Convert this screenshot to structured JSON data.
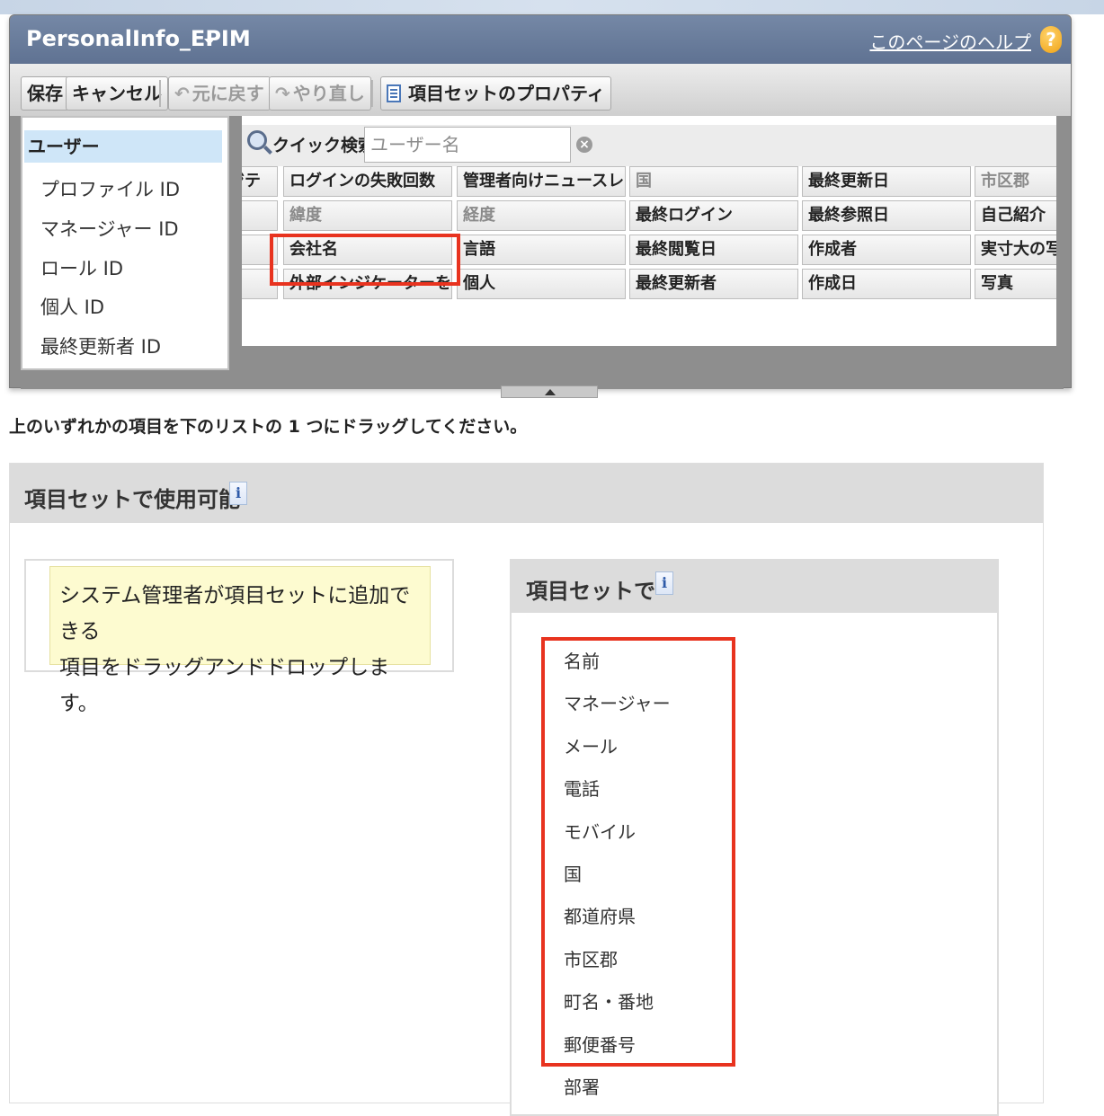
{
  "editor": {
    "title": "PersonalInfo_EPIM",
    "help_link": "このページのヘルプ",
    "help_icon_glyph": "?"
  },
  "toolbar": {
    "save": "保存",
    "cancel": "キャンセル",
    "undo": "元に戻す",
    "redo": "やり直し",
    "properties": "項目セットのプロパティ"
  },
  "field_list": {
    "header": "ユーザー",
    "items": [
      "プロファイル ID",
      "マネージャー ID",
      "ロール ID",
      "個人 ID",
      "最終更新者 ID"
    ]
  },
  "quick_search": {
    "label": "クイック検索",
    "placeholder": "ユーザー名",
    "clear_glyph": "×"
  },
  "grid": {
    "rows": [
      [
        "ッジテ",
        "ログインの失敗回数",
        "管理者向けニュースレター",
        "国",
        "最終更新日",
        "市区郡"
      ],
      [
        "",
        "緯度",
        "経度",
        "最終ログイン",
        "最終参照日",
        "自己紹介"
      ],
      [
        "",
        "会社名",
        "言語",
        "最終閲覧日",
        "作成者",
        "実寸大の写真"
      ],
      [
        "",
        "外部インジケーターを表示",
        "個人",
        "最終更新者",
        "作成日",
        "写真"
      ]
    ],
    "muted": [
      [
        false,
        false,
        false,
        true,
        false,
        true
      ],
      [
        false,
        true,
        true,
        false,
        false,
        false
      ],
      [
        false,
        false,
        false,
        false,
        false,
        false
      ],
      [
        false,
        false,
        false,
        false,
        false,
        false
      ]
    ]
  },
  "instruction": "上のいずれかの項目を下のリストの 1 つにドラッグしてください。",
  "section": {
    "title": "項目セットで使用可能",
    "info_glyph": "i",
    "note_line1": "システム管理者が項目セットに追加できる",
    "note_line2": "項目をドラッグアンドドロップします。"
  },
  "inset": {
    "title": "項目セットで",
    "info_glyph": "i",
    "items": [
      "名前",
      "マネージャー",
      "メール",
      "電話",
      "モバイル",
      "国",
      "都道府県",
      "市区郡",
      "町名・番地",
      "郵便番号",
      "部署"
    ]
  },
  "colors": {
    "highlight": "#e8331f",
    "titlebar": "#6a7d9c",
    "selected_row": "#cfe6f8",
    "note_bg": "#fdfbd0"
  }
}
